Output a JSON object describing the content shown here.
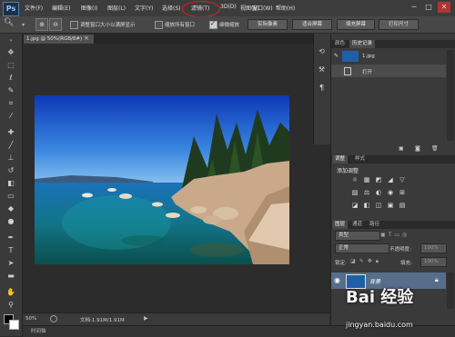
{
  "app": {
    "logo": "Ps"
  },
  "menu": [
    "文件(F)",
    "编辑(E)",
    "图像(I)",
    "图层(L)",
    "文字(Y)",
    "选择(S)",
    "滤镜(T)",
    "3D(D)",
    "视图(V)",
    "窗口(W)",
    "帮助(H)"
  ],
  "window_controls": {
    "minimize": "─",
    "maximize": "□",
    "close": "✕"
  },
  "options": {
    "resize_windows": "调整窗口大小以满屏显示",
    "zoom_all": "缩放所有窗口",
    "scrubby_zoom": "细微缩放",
    "btn_actual": "实际像素",
    "btn_fit": "适合屏幕",
    "btn_fill": "填充屏幕",
    "btn_print": "打印尺寸"
  },
  "document": {
    "tab_title": "1.jpg @ 50%(RGB/8#)",
    "close": "×"
  },
  "status": {
    "zoom": "50%",
    "doc_info": "文档:1.91M/1.91M"
  },
  "timeline": {
    "label": "时间轴"
  },
  "history_panel": {
    "tabs": [
      "颜色",
      "历史记录"
    ],
    "snapshot": "1.jpg",
    "step": "打开"
  },
  "adjust_panel": {
    "tabs": [
      "调整",
      "样式"
    ],
    "title": "添加调整",
    "icons": [
      "☼",
      "▦",
      "◩",
      "◢",
      "▽",
      "",
      "▨",
      "⚖",
      "◐",
      "◉",
      "⊞",
      "",
      "◪",
      "◧",
      "◫",
      "▣",
      "▤",
      ""
    ]
  },
  "layers_panel": {
    "tabs": [
      "图层",
      "通道",
      "路径"
    ],
    "kind": "类型",
    "blend_mode": "正常",
    "opacity_label": "不透明度:",
    "opacity_value": "100%",
    "lock_label": "锁定:",
    "fill_label": "填充:",
    "fill_value": "100%",
    "layer_name": "背景"
  },
  "watermark": {
    "brand": "Bai 经验",
    "url": "jingyan.baidu.com"
  },
  "colors": {
    "accent_ellipse": "#d82020",
    "layer_selected": "#566d8c"
  }
}
